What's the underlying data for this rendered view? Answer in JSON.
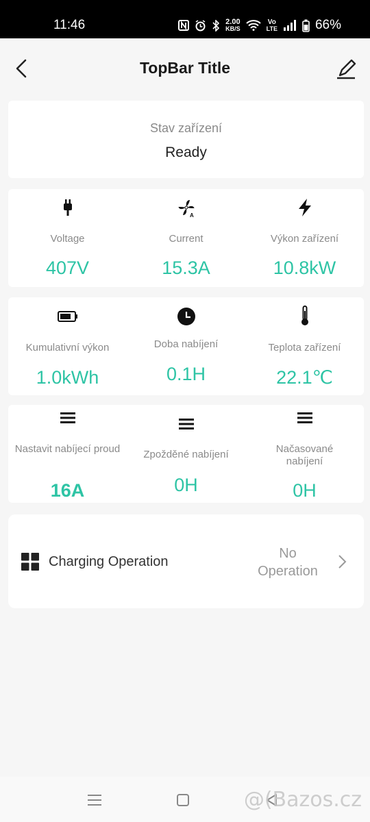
{
  "status_bar": {
    "time": "11:46",
    "net_speed_value": "2.00",
    "net_speed_unit": "KB/S",
    "volte_top": "Vo",
    "volte_bottom": "LTE",
    "battery_percent": "66%"
  },
  "top_bar": {
    "title": "TopBar Title",
    "back_icon": "chevron-left-icon",
    "edit_icon": "pencil-icon"
  },
  "device_status": {
    "label": "Stav zařízení",
    "value": "Ready"
  },
  "metrics_row1": [
    {
      "icon": "plug-icon",
      "label": "Voltage",
      "value": "407V"
    },
    {
      "icon": "fan-icon",
      "label": "Current",
      "value": "15.3A"
    },
    {
      "icon": "lightning-icon",
      "label": "Výkon zařízení",
      "value": "10.8kW"
    }
  ],
  "metrics_row2": [
    {
      "icon": "battery-icon",
      "label": "Kumulativní výkon",
      "value": "1.0kWh"
    },
    {
      "icon": "clock-icon",
      "label": "Doba nabíjení",
      "value": "0.1H"
    },
    {
      "icon": "thermometer-icon",
      "label": "Teplota zařízení",
      "value": "22.1℃"
    }
  ],
  "settings_row": [
    {
      "icon": "menu-icon",
      "label": "Nastavit nabíjecí proud",
      "value": "16A"
    },
    {
      "icon": "menu-icon",
      "label": "Zpožděné nabíjení",
      "value": "0H"
    },
    {
      "icon": "menu-icon",
      "label": "Načasované nabíjení",
      "value": "0H"
    }
  ],
  "charging_operation": {
    "icon": "grid-icon",
    "label": "Charging Operation",
    "value": "No Operation"
  },
  "nav_bar": {
    "recents_icon": "menu-icon",
    "home_icon": "square-icon",
    "back_icon": "back-triangle-icon"
  },
  "watermark": "@(Bazos.cz",
  "colors": {
    "accent": "#2ec4a5",
    "label": "#8a8a8a",
    "background": "#f6f6f6",
    "card": "#ffffff"
  }
}
